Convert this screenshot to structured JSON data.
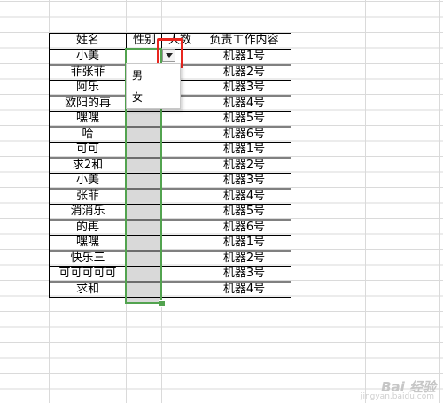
{
  "sheet": {
    "headers": {
      "name": "姓名",
      "gender": "性别",
      "count": "人数",
      "duty": "负责工作内容"
    },
    "rows": [
      {
        "name": "小美",
        "duty": "机器1号"
      },
      {
        "name": "菲张菲",
        "duty": "机器2号"
      },
      {
        "name": "阿乐",
        "duty": "机器3号"
      },
      {
        "name": "欧阳的再",
        "duty": "机器4号"
      },
      {
        "name": "嘿嘿",
        "duty": "机器5号"
      },
      {
        "name": "哈",
        "duty": "机器6号"
      },
      {
        "name": "可可",
        "duty": "机器1号"
      },
      {
        "name": "求2和",
        "duty": "机器2号"
      },
      {
        "name": "小美",
        "duty": "机器3号"
      },
      {
        "name": "张菲",
        "duty": "机器4号"
      },
      {
        "name": "消消乐",
        "duty": "机器5号"
      },
      {
        "name": "的再",
        "duty": "机器6号"
      },
      {
        "name": "嘿嘿",
        "duty": "机器1号"
      },
      {
        "name": "快乐三",
        "duty": "机器2号"
      },
      {
        "name": "可可可可可",
        "duty": "机器3号"
      },
      {
        "name": "求和",
        "duty": "机器4号"
      }
    ]
  },
  "dropdown": {
    "options": [
      "男",
      "女"
    ],
    "arrow_icon": "chevron-down-icon"
  },
  "colors": {
    "selection_border": "#52a34f",
    "selection_fill": "#d9d9d9",
    "highlight": "#e8261f",
    "gridline": "#dadada",
    "table_border": "#000000"
  },
  "watermark": {
    "logo_text": "Bai 经验",
    "url": "jingyan.baidu.com"
  }
}
